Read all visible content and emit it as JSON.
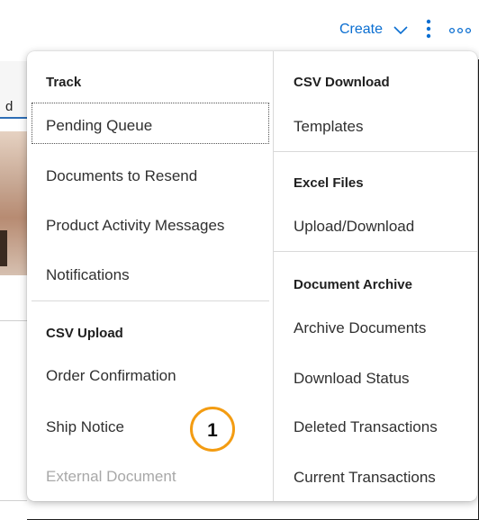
{
  "header": {
    "create_label": "Create",
    "create_chevron_icon": "chevron-down-icon",
    "more_vertical_icon": "vertical-more-icon",
    "more_horizontal_icon": "horizontal-more-icon"
  },
  "background": {
    "partial_text": "d"
  },
  "menu": {
    "left": {
      "track_heading": "Track",
      "track_items": [
        "Pending Queue",
        "Documents to Resend",
        "Product Activity Messages",
        "Notifications"
      ],
      "csv_upload_heading": "CSV Upload",
      "csv_upload_items": [
        "Order Confirmation",
        "Ship Notice",
        "External Document"
      ]
    },
    "right": {
      "csv_download_heading": "CSV Download",
      "csv_download_items": [
        "Templates"
      ],
      "excel_heading": "Excel Files",
      "excel_items": [
        "Upload/Download"
      ],
      "archive_heading": "Document Archive",
      "archive_items": [
        "Archive Documents",
        "Download Status",
        "Deleted Transactions",
        "Current Transactions"
      ]
    }
  },
  "callout": {
    "number": "1"
  },
  "colors": {
    "link_blue": "#0a6ed1",
    "callout_orange": "#f39c12",
    "disabled_text": "#a8a8a8"
  }
}
